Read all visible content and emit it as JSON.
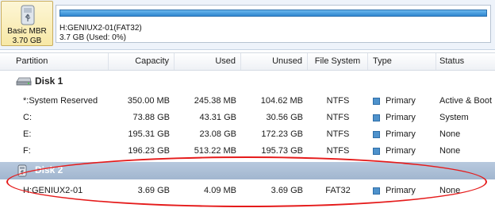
{
  "disk_map": {
    "disk_type": "Basic MBR",
    "disk_size": "3.70 GB",
    "partition_name": "H:GENIUX2-01(FAT32)",
    "partition_info": "3.7 GB (Used: 0%)"
  },
  "columns": [
    "Partition",
    "Capacity",
    "Used",
    "Unused",
    "File System",
    "Type",
    "Status"
  ],
  "disk1": {
    "label": "Disk 1",
    "partitions": [
      {
        "partition": "*:System Reserved",
        "capacity": "350.00 MB",
        "used": "245.38 MB",
        "unused": "104.62 MB",
        "fs": "NTFS",
        "type": "Primary",
        "status": "Active & Boot"
      },
      {
        "partition": "C:",
        "capacity": "73.88 GB",
        "used": "43.31 GB",
        "unused": "30.56 GB",
        "fs": "NTFS",
        "type": "Primary",
        "status": "System"
      },
      {
        "partition": "E:",
        "capacity": "195.31 GB",
        "used": "23.08 GB",
        "unused": "172.23 GB",
        "fs": "NTFS",
        "type": "Primary",
        "status": "None"
      },
      {
        "partition": "F:",
        "capacity": "196.23 GB",
        "used": "513.22 MB",
        "unused": "195.73 GB",
        "fs": "NTFS",
        "type": "Primary",
        "status": "None"
      }
    ]
  },
  "disk2": {
    "label": "Disk 2",
    "partitions": [
      {
        "partition": "H:GENIUX2-01",
        "capacity": "3.69 GB",
        "used": "4.09 MB",
        "unused": "3.69 GB",
        "fs": "FAT32",
        "type": "Primary",
        "status": "None"
      }
    ]
  },
  "colors": {
    "primary_square": "#4e92cc",
    "selected_group_bg": "#a2b6cf",
    "highlight_annotation": "#e51b1b"
  },
  "icons": {
    "disk_map_tile": "usb-drive-icon",
    "disk1_group": "hard-disk-icon",
    "disk2_group": "usb-drive-icon",
    "type_marker": "primary-partition-square"
  }
}
